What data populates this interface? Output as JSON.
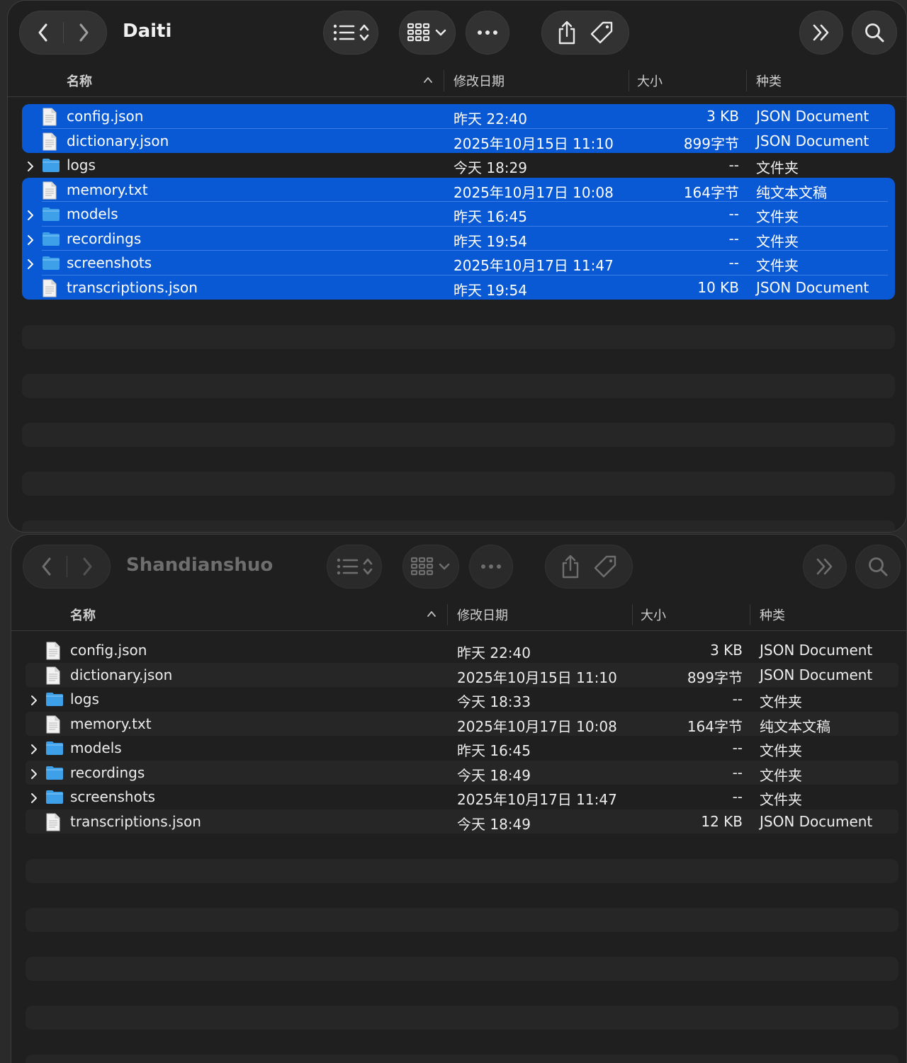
{
  "columns": {
    "name": "名称",
    "date": "修改日期",
    "size": "大小",
    "kind": "种类"
  },
  "windows": [
    {
      "title": "Daiti",
      "files": [
        {
          "name": "config.json",
          "date": "昨天 22:40",
          "size": "3 KB",
          "kind": "JSON Document",
          "type": "file",
          "selected": true
        },
        {
          "name": "dictionary.json",
          "date": "2025年10月15日 11:10",
          "size": "899字节",
          "kind": "JSON Document",
          "type": "file",
          "selected": true
        },
        {
          "name": "logs",
          "date": "今天 18:29",
          "size": "--",
          "kind": "文件夹",
          "type": "folder",
          "selected": false
        },
        {
          "name": "memory.txt",
          "date": "2025年10月17日 10:08",
          "size": "164字节",
          "kind": "纯文本文稿",
          "type": "file",
          "selected": true
        },
        {
          "name": "models",
          "date": "昨天 16:45",
          "size": "--",
          "kind": "文件夹",
          "type": "folder",
          "selected": true
        },
        {
          "name": "recordings",
          "date": "昨天 19:54",
          "size": "--",
          "kind": "文件夹",
          "type": "folder",
          "selected": true
        },
        {
          "name": "screenshots",
          "date": "2025年10月17日 11:47",
          "size": "--",
          "kind": "文件夹",
          "type": "folder",
          "selected": true
        },
        {
          "name": "transcriptions.json",
          "date": "昨天 19:54",
          "size": "10 KB",
          "kind": "JSON Document",
          "type": "file",
          "selected": true
        }
      ]
    },
    {
      "title": "Shandianshuo",
      "files": [
        {
          "name": "config.json",
          "date": "昨天 22:40",
          "size": "3 KB",
          "kind": "JSON Document",
          "type": "file",
          "selected": false
        },
        {
          "name": "dictionary.json",
          "date": "2025年10月15日 11:10",
          "size": "899字节",
          "kind": "JSON Document",
          "type": "file",
          "selected": false
        },
        {
          "name": "logs",
          "date": "今天 18:33",
          "size": "--",
          "kind": "文件夹",
          "type": "folder",
          "selected": false
        },
        {
          "name": "memory.txt",
          "date": "2025年10月17日 10:08",
          "size": "164字节",
          "kind": "纯文本文稿",
          "type": "file",
          "selected": false
        },
        {
          "name": "models",
          "date": "昨天 16:45",
          "size": "--",
          "kind": "文件夹",
          "type": "folder",
          "selected": false
        },
        {
          "name": "recordings",
          "date": "今天 18:49",
          "size": "--",
          "kind": "文件夹",
          "type": "folder",
          "selected": false
        },
        {
          "name": "screenshots",
          "date": "2025年10月17日 11:47",
          "size": "--",
          "kind": "文件夹",
          "type": "folder",
          "selected": false
        },
        {
          "name": "transcriptions.json",
          "date": "今天 18:49",
          "size": "12 KB",
          "kind": "JSON Document",
          "type": "file",
          "selected": false
        }
      ]
    }
  ],
  "icons": {
    "back": "chevron-left-icon",
    "forward": "chevron-right-icon",
    "list_view": "list-view-icon",
    "group": "grid-group-icon",
    "more": "ellipsis-icon",
    "share": "share-icon",
    "tag": "tag-icon",
    "overflow": "double-chevron-right-icon",
    "search": "search-icon",
    "file": "document-icon",
    "folder": "folder-icon",
    "disclosure": "disclosure-chevron-icon"
  },
  "colors": {
    "selection": "#0a59d4",
    "folder": "#3fa0ea",
    "window_bg": "#1f1f1f"
  }
}
